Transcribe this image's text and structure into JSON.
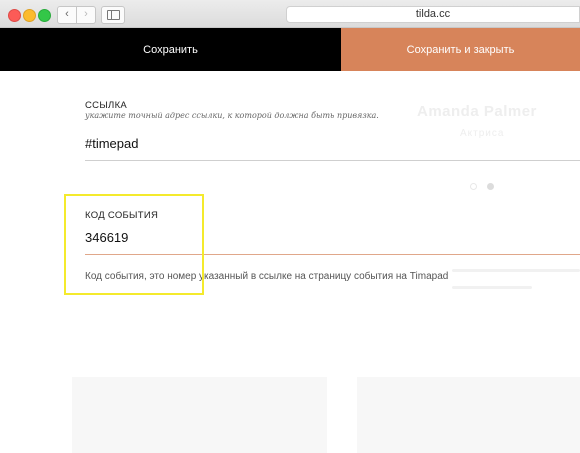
{
  "browser": {
    "address": "tilda.cc",
    "back_glyph": "‹",
    "forward_glyph": "›"
  },
  "toolbar": {
    "save_label": "Сохранить",
    "save_close_label": "Сохранить и закрыть",
    "save_color": "#000000",
    "save_close_color": "#d7845a"
  },
  "form": {
    "link": {
      "label": "ССЫЛКА",
      "hint": "укажите точный адрес ссылки, к которой должна быть привязка.",
      "value": "#timepad"
    },
    "event_code": {
      "label": "КОД СОБЫТИЯ",
      "value": "346619",
      "description": "Код события, это номер указанный в ссылке на страницу события на Timapad",
      "accent_color": "#e0a78a"
    }
  },
  "background_page": {
    "title": "Amanda Palmer",
    "subtitle": "Актриса"
  },
  "highlight_color": "#f4ea2c"
}
